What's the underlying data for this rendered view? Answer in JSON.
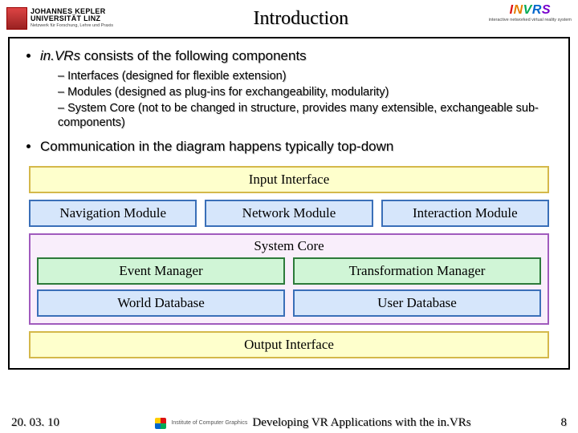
{
  "header": {
    "jku_line1": "JOHANNES KEPLER",
    "jku_line2": "UNIVERSITÄT LINZ",
    "jku_sub": "Netzwerk für Forschung, Lehre und Praxis",
    "title": "Introduction",
    "invrs_sub": "interactive networked virtual reality system"
  },
  "bullet1_prefix": "in.VRs",
  "bullet1_rest": " consists of the following components",
  "sub": {
    "a": "Interfaces (designed for flexible extension)",
    "b": "Modules (designed as plug-ins for exchangeability, modularity)",
    "c": "System Core (not to be changed in structure, provides many extensible, exchangeable sub-components)"
  },
  "bullet2": "Communication in the diagram happens typically top-down",
  "diagram": {
    "input": "Input Interface",
    "nav": "Navigation Module",
    "net": "Network Module",
    "inter": "Interaction Module",
    "core_label": "System Core",
    "event": "Event Manager",
    "trans": "Transformation Manager",
    "world": "World Database",
    "user": "User Database",
    "output": "Output Interface"
  },
  "footer": {
    "date": "20. 03. 10",
    "icg": "Institute of Computer Graphics",
    "center": "Developing VR Applications with the in.VRs",
    "page": "8"
  },
  "chart_data": {
    "type": "diagram",
    "title": "in.VRs component architecture",
    "layers": [
      {
        "name": "Input Interface",
        "kind": "interface"
      },
      {
        "name": "Modules",
        "kind": "modules",
        "items": [
          "Navigation Module",
          "Network Module",
          "Interaction Module"
        ]
      },
      {
        "name": "System Core",
        "kind": "core",
        "items": [
          "Event Manager",
          "Transformation Manager",
          "World Database",
          "User Database"
        ]
      },
      {
        "name": "Output Interface",
        "kind": "interface"
      }
    ],
    "flow": "top-down"
  }
}
